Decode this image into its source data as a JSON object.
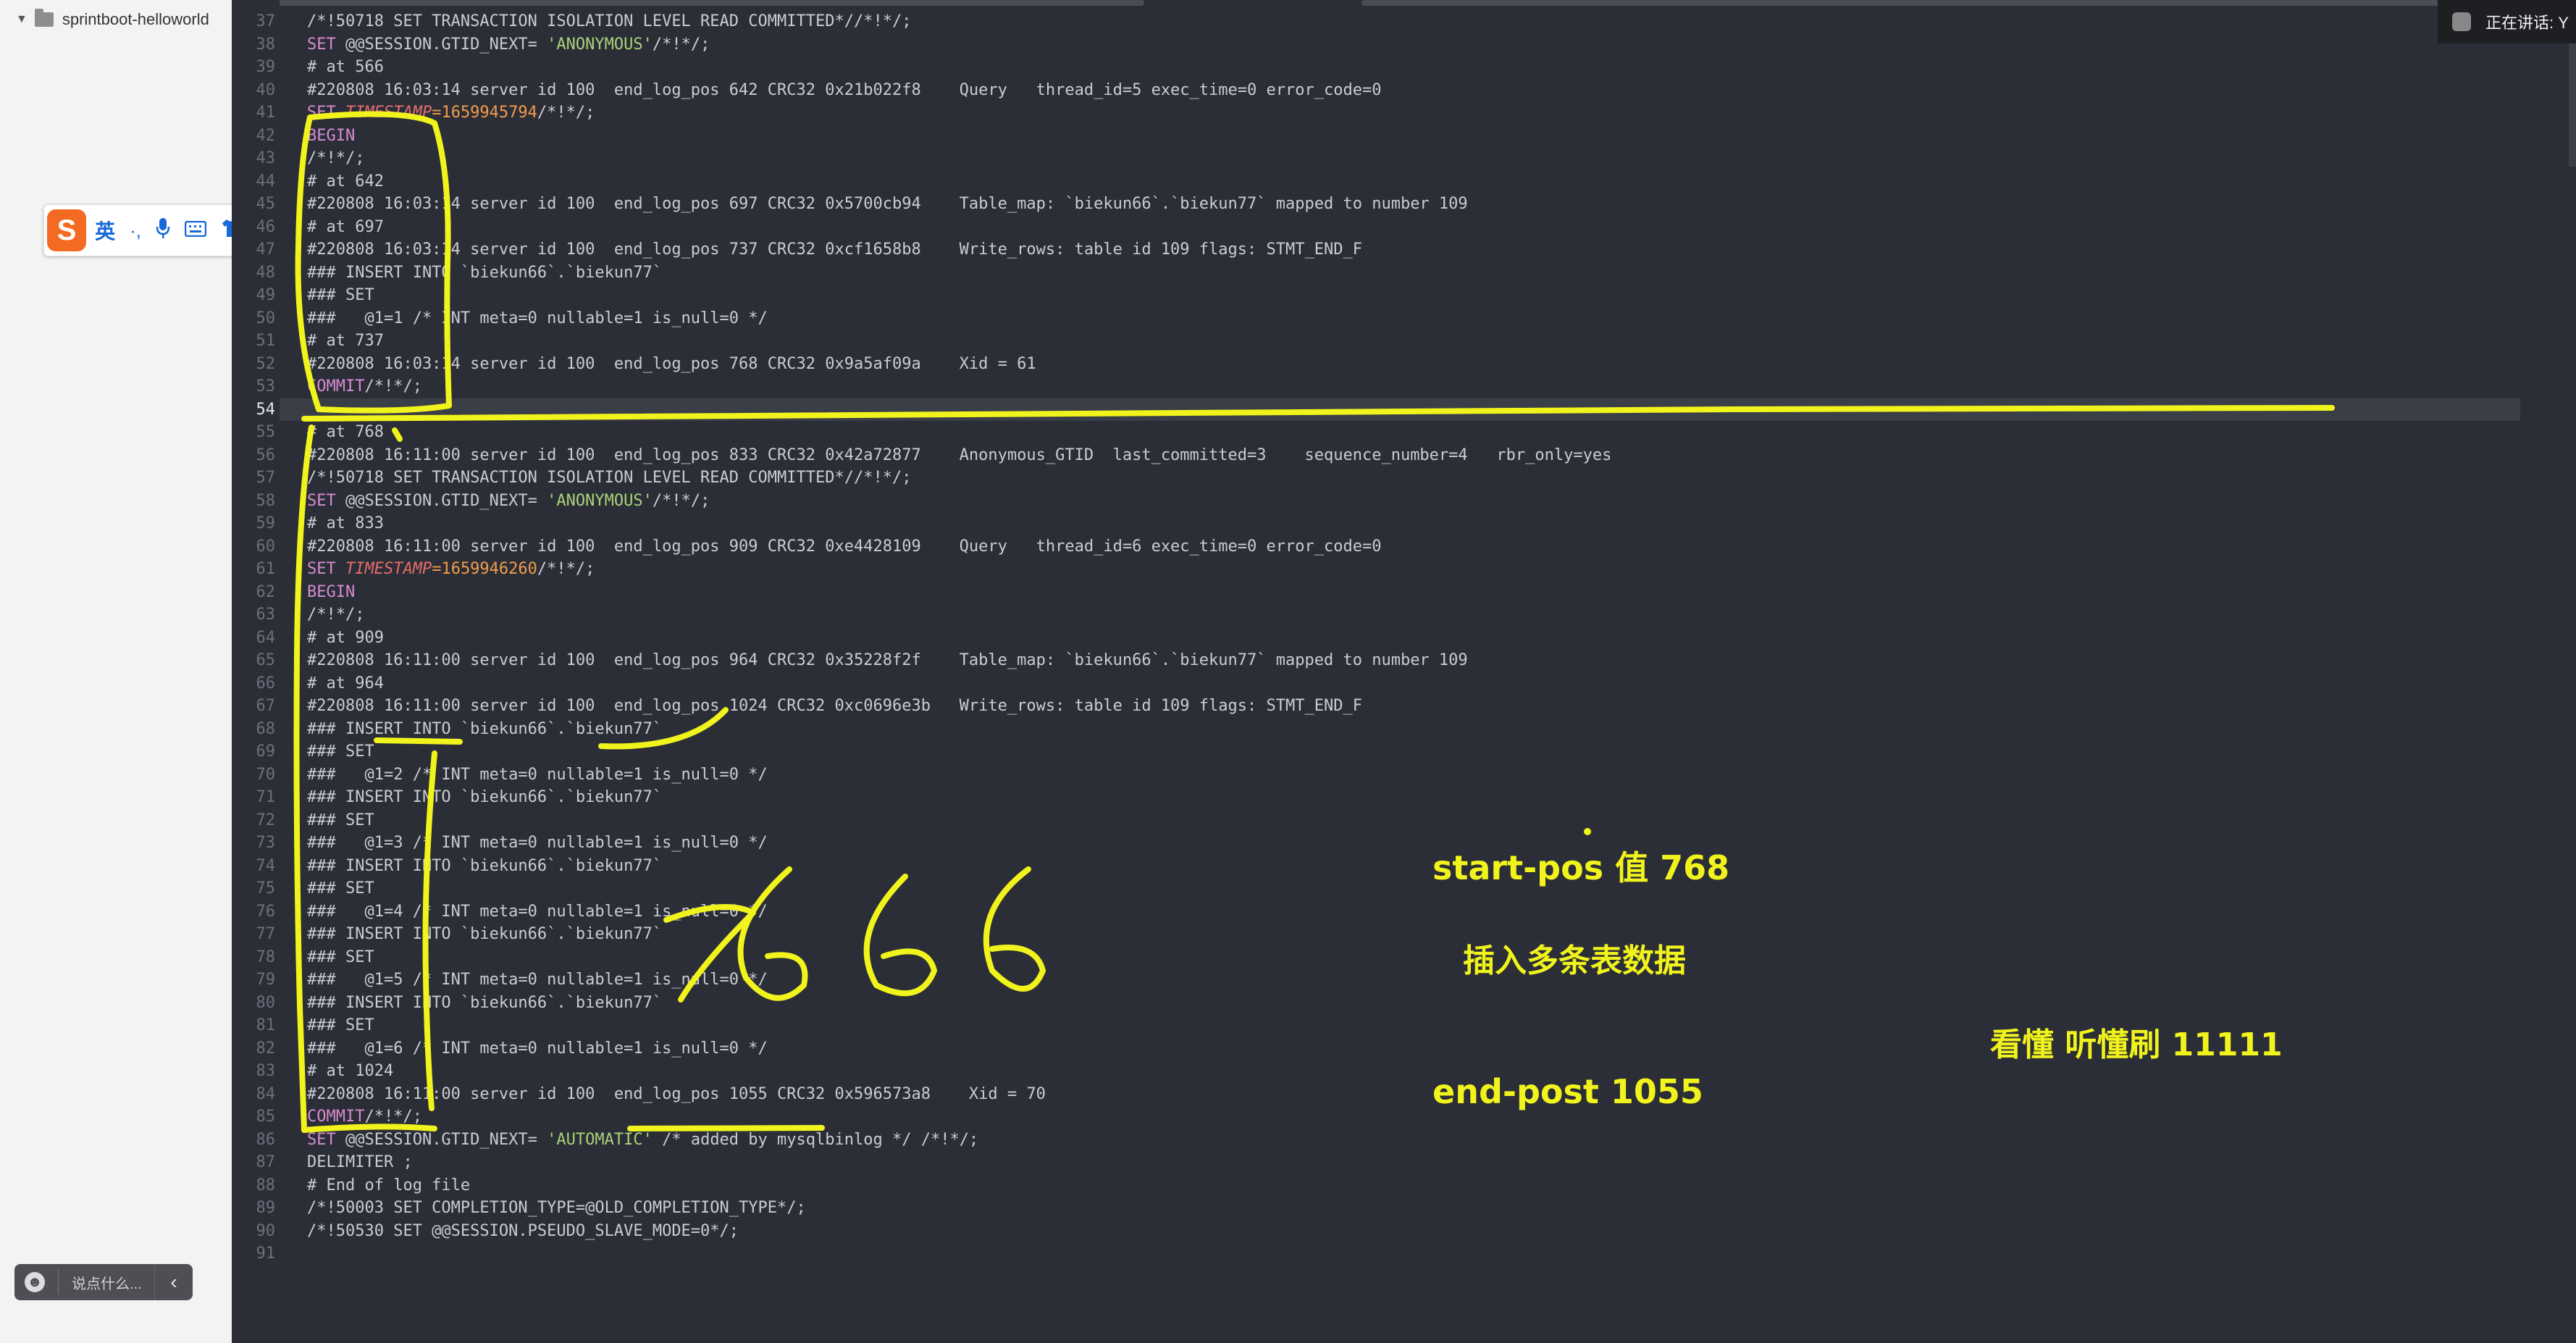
{
  "sidebar": {
    "project_name": "sprintboot-helloworld"
  },
  "ime": {
    "logo": "S",
    "lang": "英",
    "tools": [
      "·,",
      "microphone-icon",
      "keyboard-icon",
      "shirt-icon",
      "grid-icon"
    ]
  },
  "comment": {
    "placeholder": "说点什么...",
    "collapse_glyph": "‹"
  },
  "live_status": "正在讲话: Y",
  "editor": {
    "current_line": 54,
    "lines": [
      {
        "n": 37,
        "segs": [
          [
            "/*!50718 SET TRANSACTION ISOLATION LEVEL READ COMMITTED*//*!*/;",
            ""
          ]
        ]
      },
      {
        "n": 38,
        "segs": [
          [
            "SET ",
            "kw"
          ],
          [
            "@@SESSION.GTID_NEXT= ",
            ""
          ],
          [
            "'ANONYMOUS'",
            "str"
          ],
          [
            "/*!*/;",
            ""
          ]
        ]
      },
      {
        "n": 39,
        "segs": [
          [
            "# at 566",
            ""
          ]
        ]
      },
      {
        "n": 40,
        "segs": [
          [
            "#220808 16:03:14 server id 100  end_log_pos 642 CRC32 0x21b022f8    Query   thread_id=5 exec_time=0 error_code=0",
            ""
          ]
        ]
      },
      {
        "n": 41,
        "segs": [
          [
            "SET ",
            "kw"
          ],
          [
            "TIMESTAMP",
            "var"
          ],
          [
            "=1659945794",
            "num"
          ],
          [
            "/*!*/;",
            ""
          ]
        ]
      },
      {
        "n": 42,
        "segs": [
          [
            "BEGIN",
            "kw"
          ]
        ]
      },
      {
        "n": 43,
        "segs": [
          [
            "/*!*/;",
            ""
          ]
        ]
      },
      {
        "n": 44,
        "segs": [
          [
            "# at 642",
            ""
          ]
        ]
      },
      {
        "n": 45,
        "segs": [
          [
            "#220808 16:03:14 server id 100  end_log_pos 697 CRC32 0x5700cb94    Table_map: `biekun66`.`biekun77` mapped to number 109",
            ""
          ]
        ]
      },
      {
        "n": 46,
        "segs": [
          [
            "# at 697",
            ""
          ]
        ]
      },
      {
        "n": 47,
        "segs": [
          [
            "#220808 16:03:14 server id 100  end_log_pos 737 CRC32 0xcf1658b8    Write_rows: table id 109 flags: STMT_END_F",
            ""
          ]
        ]
      },
      {
        "n": 48,
        "segs": [
          [
            "### INSERT INTO `biekun66`.`biekun77`",
            ""
          ]
        ]
      },
      {
        "n": 49,
        "segs": [
          [
            "### SET",
            ""
          ]
        ]
      },
      {
        "n": 50,
        "segs": [
          [
            "###   @1=1 /* INT meta=0 nullable=1 is_null=0 */",
            ""
          ]
        ]
      },
      {
        "n": 51,
        "segs": [
          [
            "# at 737",
            ""
          ]
        ]
      },
      {
        "n": 52,
        "segs": [
          [
            "#220808 16:03:14 server id 100  end_log_pos 768 CRC32 0x9a5af09a    Xid = 61",
            ""
          ]
        ]
      },
      {
        "n": 53,
        "segs": [
          [
            "COMMIT",
            "kw"
          ],
          [
            "/*!*/;",
            ""
          ]
        ]
      },
      {
        "n": 54,
        "segs": []
      },
      {
        "n": 55,
        "segs": [
          [
            "# at 768",
            ""
          ]
        ]
      },
      {
        "n": 56,
        "segs": [
          [
            "#220808 16:11:00 server id 100  end_log_pos 833 CRC32 0x42a72877    Anonymous_GTID  last_committed=3    sequence_number=4   rbr_only=yes",
            ""
          ]
        ]
      },
      {
        "n": 57,
        "segs": [
          [
            "/*!50718 SET TRANSACTION ISOLATION LEVEL READ COMMITTED*//*!*/;",
            ""
          ]
        ]
      },
      {
        "n": 58,
        "segs": [
          [
            "SET ",
            "kw"
          ],
          [
            "@@SESSION.GTID_NEXT= ",
            ""
          ],
          [
            "'ANONYMOUS'",
            "str"
          ],
          [
            "/*!*/;",
            ""
          ]
        ]
      },
      {
        "n": 59,
        "segs": [
          [
            "# at 833",
            ""
          ]
        ]
      },
      {
        "n": 60,
        "segs": [
          [
            "#220808 16:11:00 server id 100  end_log_pos 909 CRC32 0xe4428109    Query   thread_id=6 exec_time=0 error_code=0",
            ""
          ]
        ]
      },
      {
        "n": 61,
        "segs": [
          [
            "SET ",
            "kw"
          ],
          [
            "TIMESTAMP",
            "var"
          ],
          [
            "=1659946260",
            "num"
          ],
          [
            "/*!*/;",
            ""
          ]
        ]
      },
      {
        "n": 62,
        "segs": [
          [
            "BEGIN",
            "kw"
          ]
        ]
      },
      {
        "n": 63,
        "segs": [
          [
            "/*!*/;",
            ""
          ]
        ]
      },
      {
        "n": 64,
        "segs": [
          [
            "# at 909",
            ""
          ]
        ]
      },
      {
        "n": 65,
        "segs": [
          [
            "#220808 16:11:00 server id 100  end_log_pos 964 CRC32 0x35228f2f    Table_map: `biekun66`.`biekun77` mapped to number 109",
            ""
          ]
        ]
      },
      {
        "n": 66,
        "segs": [
          [
            "# at 964",
            ""
          ]
        ]
      },
      {
        "n": 67,
        "segs": [
          [
            "#220808 16:11:00 server id 100  end_log_pos 1024 CRC32 0xc0696e3b   Write_rows: table id 109 flags: STMT_END_F",
            ""
          ]
        ]
      },
      {
        "n": 68,
        "segs": [
          [
            "### INSERT INTO `biekun66`.`biekun77`",
            ""
          ]
        ]
      },
      {
        "n": 69,
        "segs": [
          [
            "### SET",
            ""
          ]
        ]
      },
      {
        "n": 70,
        "segs": [
          [
            "###   @1=2 /* INT meta=0 nullable=1 is_null=0 */",
            ""
          ]
        ]
      },
      {
        "n": 71,
        "segs": [
          [
            "### INSERT INTO `biekun66`.`biekun77`",
            ""
          ]
        ]
      },
      {
        "n": 72,
        "segs": [
          [
            "### SET",
            ""
          ]
        ]
      },
      {
        "n": 73,
        "segs": [
          [
            "###   @1=3 /* INT meta=0 nullable=1 is_null=0 */",
            ""
          ]
        ]
      },
      {
        "n": 74,
        "segs": [
          [
            "### INSERT INTO `biekun66`.`biekun77`",
            ""
          ]
        ]
      },
      {
        "n": 75,
        "segs": [
          [
            "### SET",
            ""
          ]
        ]
      },
      {
        "n": 76,
        "segs": [
          [
            "###   @1=4 /* INT meta=0 nullable=1 is_null=0 */",
            ""
          ]
        ]
      },
      {
        "n": 77,
        "segs": [
          [
            "### INSERT INTO `biekun66`.`biekun77`",
            ""
          ]
        ]
      },
      {
        "n": 78,
        "segs": [
          [
            "### SET",
            ""
          ]
        ]
      },
      {
        "n": 79,
        "segs": [
          [
            "###   @1=5 /* INT meta=0 nullable=1 is_null=0 */",
            ""
          ]
        ]
      },
      {
        "n": 80,
        "segs": [
          [
            "### INSERT INTO `biekun66`.`biekun77`",
            ""
          ]
        ]
      },
      {
        "n": 81,
        "segs": [
          [
            "### SET",
            ""
          ]
        ]
      },
      {
        "n": 82,
        "segs": [
          [
            "###   @1=6 /* INT meta=0 nullable=1 is_null=0 */",
            ""
          ]
        ]
      },
      {
        "n": 83,
        "segs": [
          [
            "# at 1024",
            ""
          ]
        ]
      },
      {
        "n": 84,
        "segs": [
          [
            "#220808 16:11:00 server id 100  end_log_pos 1055 CRC32 0x596573a8    Xid = 70",
            ""
          ]
        ]
      },
      {
        "n": 85,
        "segs": [
          [
            "COMMIT",
            "kw"
          ],
          [
            "/*!*/;",
            ""
          ]
        ]
      },
      {
        "n": 86,
        "segs": [
          [
            "SET ",
            "kw"
          ],
          [
            "@@SESSION.GTID_NEXT= ",
            ""
          ],
          [
            "'AUTOMATIC'",
            "str"
          ],
          [
            " /* added by mysqlbinlog */ /*!*/;",
            ""
          ]
        ]
      },
      {
        "n": 87,
        "segs": [
          [
            "DELIMITER ;",
            ""
          ]
        ]
      },
      {
        "n": 88,
        "segs": [
          [
            "# End of log file",
            ""
          ]
        ]
      },
      {
        "n": 89,
        "segs": [
          [
            "/*!50003 SET COMPLETION_TYPE=@OLD_COMPLETION_TYPE*/;",
            ""
          ]
        ]
      },
      {
        "n": 90,
        "segs": [
          [
            "/*!50530 SET @@SESSION.PSEUDO_SLAVE_MODE=0*/;",
            ""
          ]
        ]
      },
      {
        "n": 91,
        "segs": []
      }
    ]
  },
  "annotations": {
    "start_pos": "start-pos 值  768",
    "insert_multi": "插入多条表数据",
    "end_pos": "end-post  1055",
    "understand": "看懂 听懂刷 11111",
    "handwritten_number": "7666",
    "color": "#f1f31c"
  },
  "colors": {
    "editor_bg": "#2b2e36",
    "highlight": "#f1f31c",
    "keyword": "#d68bd1",
    "string": "#a9d27a",
    "number": "#f39c4b"
  }
}
